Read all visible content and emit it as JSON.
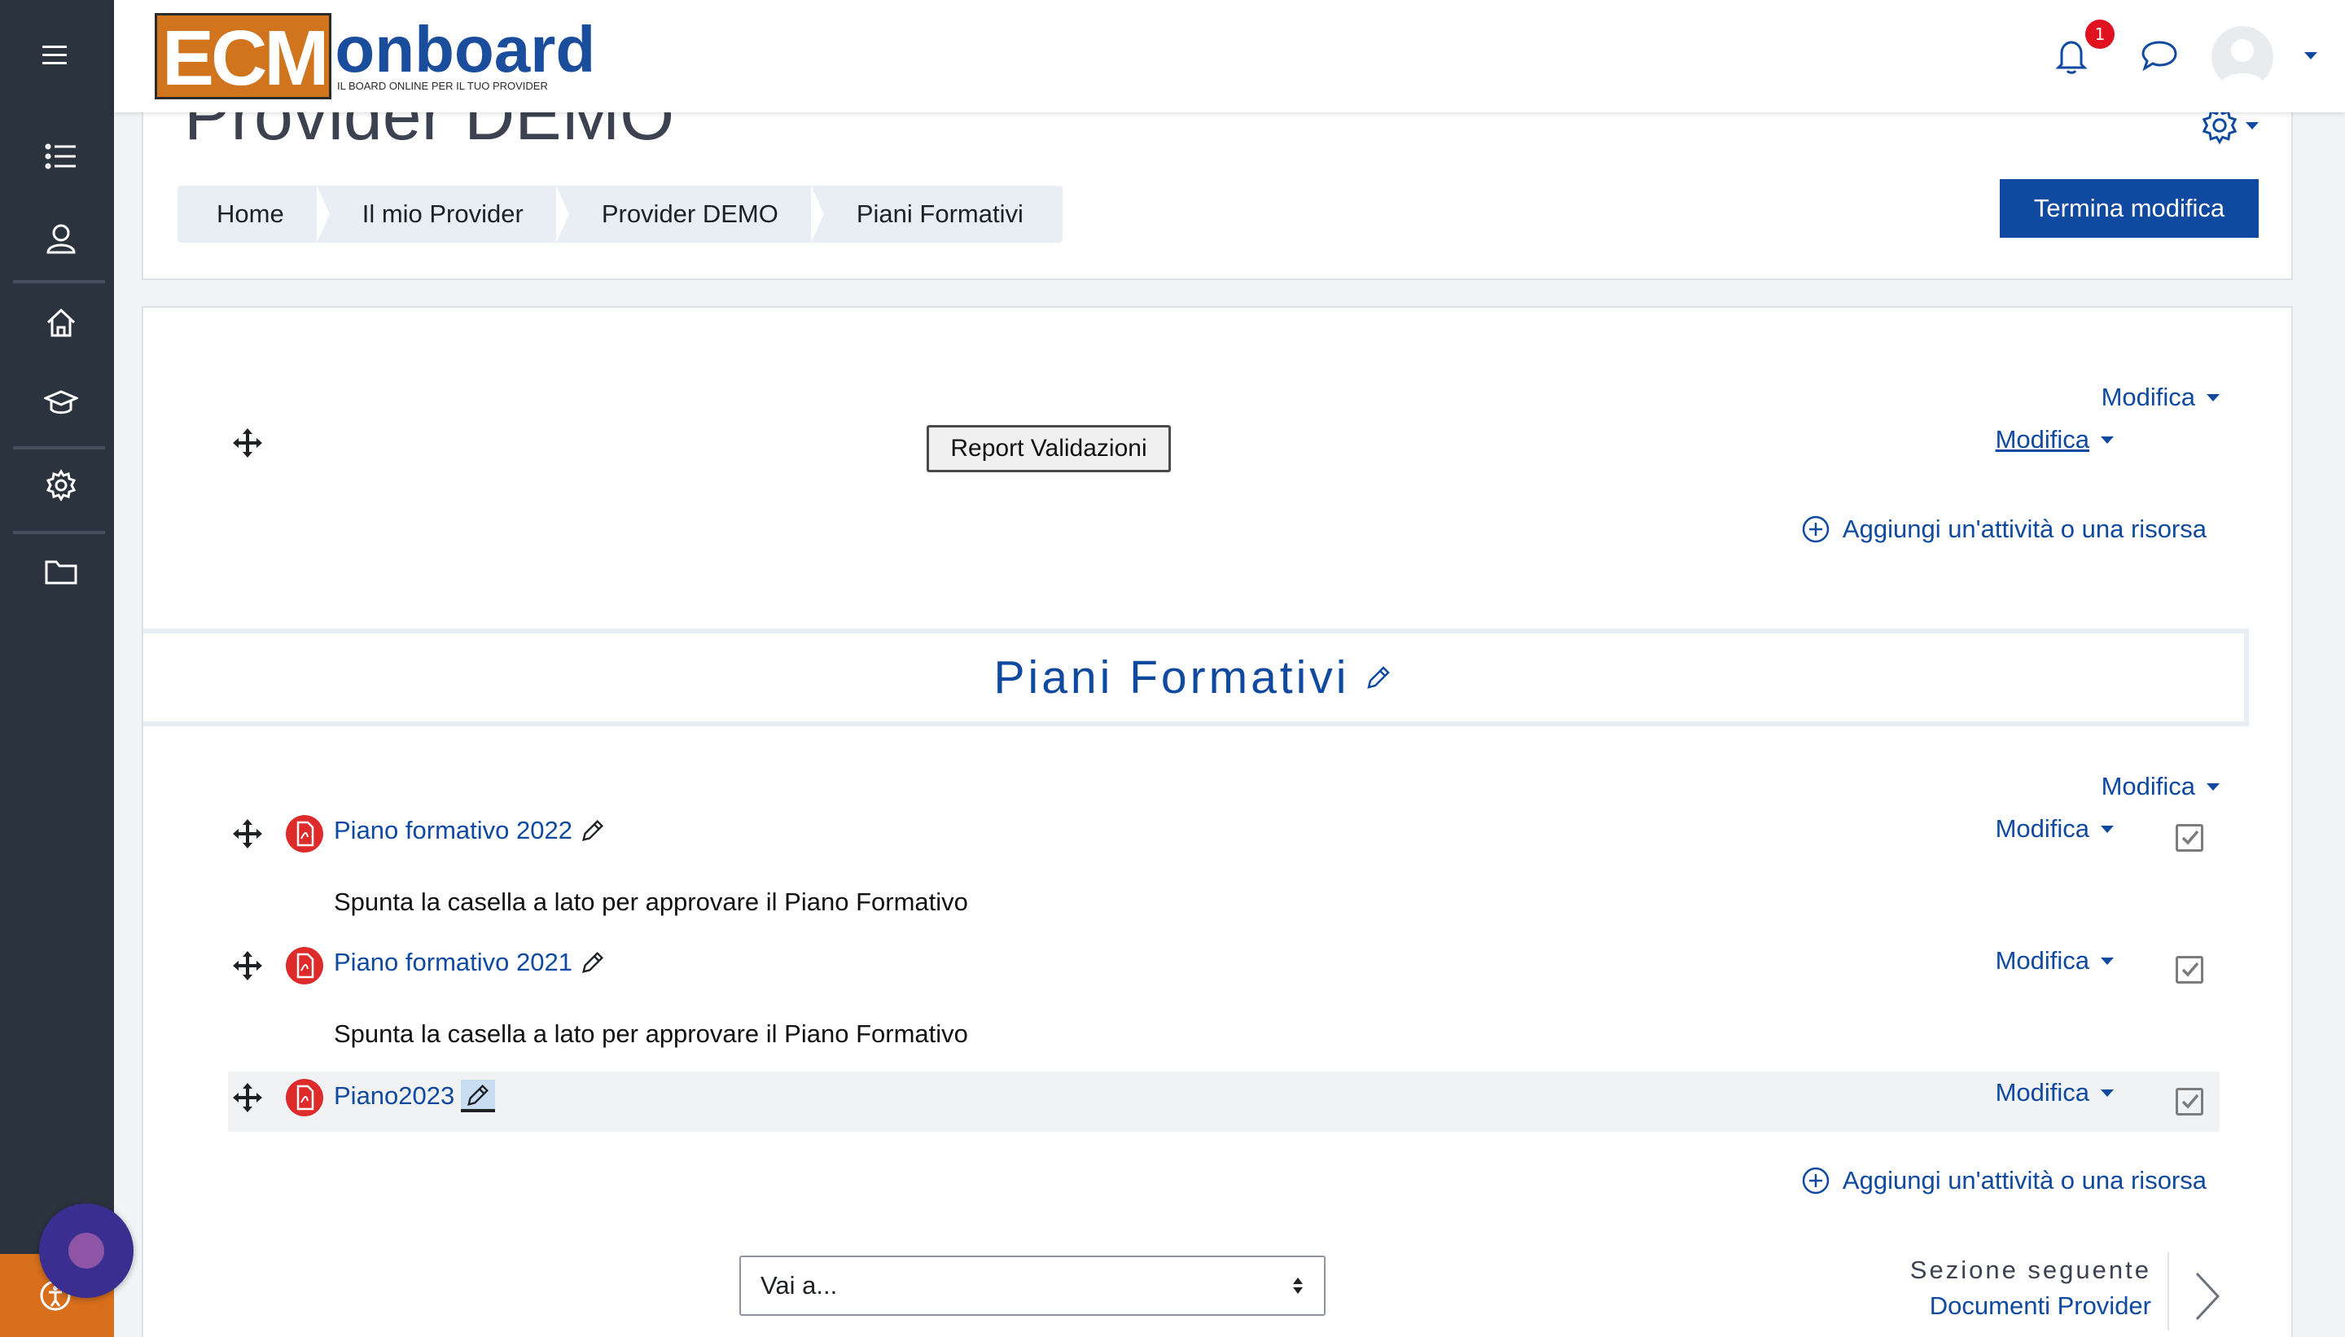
{
  "navbar": {
    "logo_ecm": "ECM",
    "logo_onboard": "onboard",
    "logo_tagline": "IL BOARD ONLINE PER IL TUO PROVIDER",
    "notification_count": "1"
  },
  "header": {
    "title": "Provider DEMO",
    "breadcrumb": [
      "Home",
      "Il mio Provider",
      "Provider DEMO",
      "Piani Formativi"
    ],
    "edit_button": "Termina modifica"
  },
  "top_section": {
    "modifica_section": "Modifica",
    "modifica_item": "Modifica",
    "report_button": "Report Validazioni",
    "add_activity": "Aggiungi un'attività o una risorsa"
  },
  "piani_section": {
    "title": "Piani Formativi",
    "modifica_section": "Modifica",
    "items": [
      {
        "name": "Piano formativo 2022",
        "modifica": "Modifica",
        "description": "Spunta la casella a lato per approvare il Piano Formativo"
      },
      {
        "name": "Piano formativo 2021",
        "modifica": "Modifica",
        "description": "Spunta la casella a lato per approvare il Piano Formativo"
      },
      {
        "name": "Piano2023",
        "modifica": "Modifica",
        "description": ""
      }
    ],
    "add_activity": "Aggiungi un'attività o una risorsa"
  },
  "footer_nav": {
    "jump_placeholder": "Vai a...",
    "next_label": "Sezione seguente",
    "next_link": "Documenti Provider"
  },
  "colors": {
    "sidebar": "#2b333f",
    "primary": "#0f4aa0",
    "brand_orange": "#d0741d",
    "badge_red": "#e0121f"
  }
}
